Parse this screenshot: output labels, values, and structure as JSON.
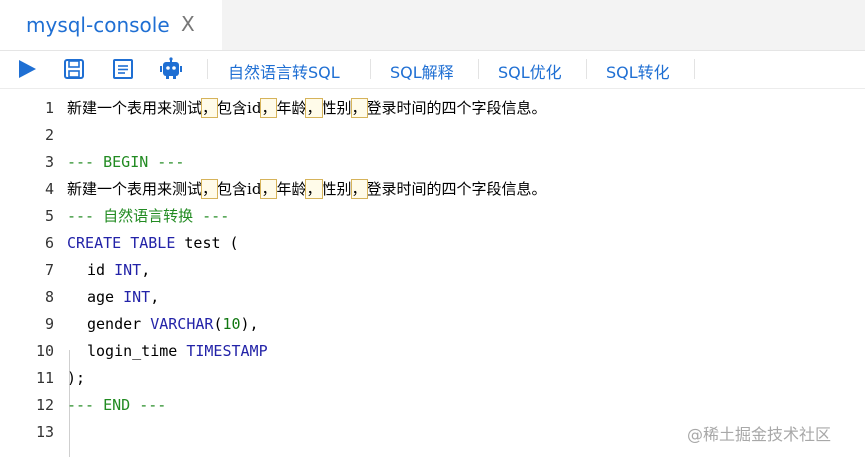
{
  "tab": {
    "title": "mysql-console",
    "close": "X"
  },
  "toolbar": {
    "nl2sql": "自然语言转SQL",
    "explain": "SQL解释",
    "optimize": "SQL优化",
    "convert": "SQL转化"
  },
  "editor": {
    "line_numbers": [
      "1",
      "2",
      "3",
      "4",
      "5",
      "6",
      "7",
      "8",
      "9",
      "10",
      "11",
      "12",
      "13"
    ],
    "l1": {
      "p1": "新建一个表用来测试",
      "c1": "，",
      "p2": "包含",
      "p3": "id",
      "c2": "，",
      "p4": "年龄",
      "c3": "，",
      "p5": "性别",
      "c4": "，",
      "p6": "登录时间的四个字段信息。"
    },
    "l3": "--- BEGIN ---",
    "l4": {
      "p1": "新建一个表用来测试",
      "c1": "，",
      "p2": "包含",
      "p3": "id",
      "c2": "，",
      "p4": "年龄",
      "c3": "，",
      "p5": "性别",
      "c4": "，",
      "p6": "登录时间的四个字段信息。"
    },
    "l5": "--- 自然语言转换 ---",
    "l6": {
      "kw": "CREATE TABLE",
      "rest": " test ("
    },
    "l7": {
      "name": "id",
      "type": "INT",
      "end": ","
    },
    "l8": {
      "name": "age",
      "type": "INT",
      "end": ","
    },
    "l9": {
      "name": "gender",
      "type": "VARCHAR",
      "open": "(",
      "num": "10",
      "close": "),"
    },
    "l10": {
      "name": "login_time",
      "type": "TIMESTAMP"
    },
    "l11": ");",
    "l12": "--- END ---"
  },
  "watermark": "@稀土掘金技术社区",
  "colors": {
    "accent": "#1f6fd3",
    "keyword": "#2323a8",
    "comment": "#228b22"
  }
}
